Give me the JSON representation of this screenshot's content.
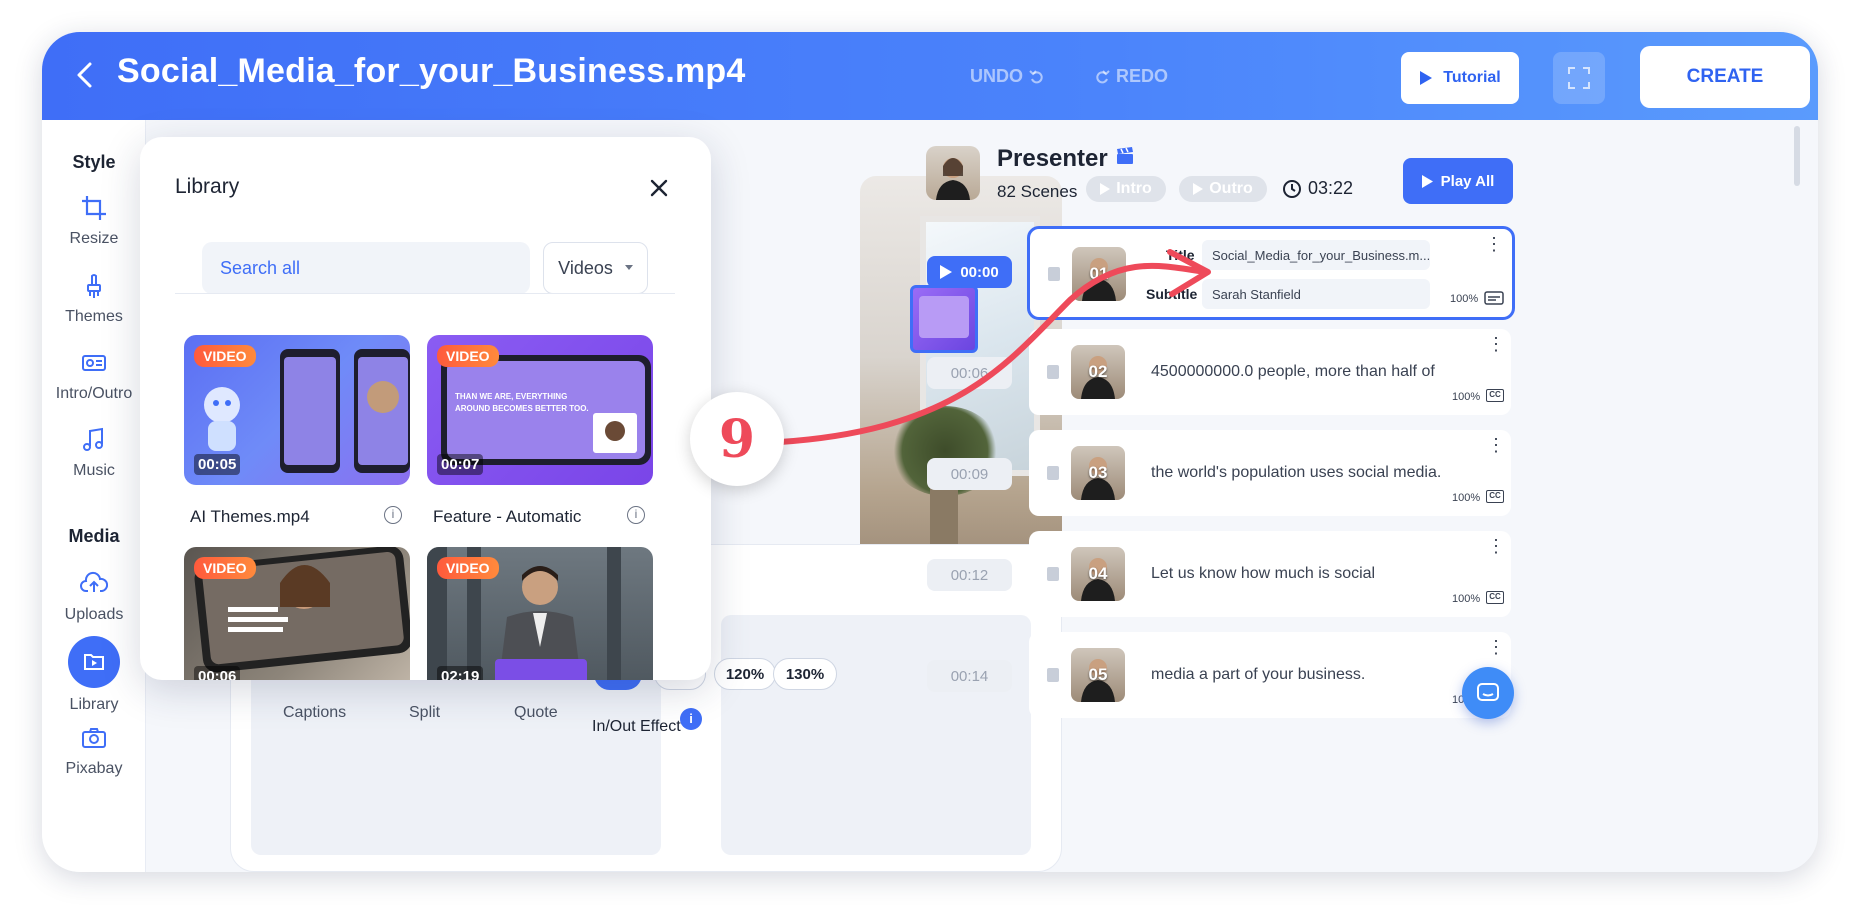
{
  "header": {
    "title": "Social_Media_for_your_Business.mp4",
    "undo_label": "UNDO",
    "redo_label": "REDO",
    "tutorial_label": "Tutorial",
    "create_label": "CREATE"
  },
  "sidebar": {
    "style_heading": "Style",
    "media_heading": "Media",
    "items": [
      {
        "label": "Resize",
        "icon": "crop-icon"
      },
      {
        "label": "Themes",
        "icon": "brush-icon"
      },
      {
        "label": "Intro/Outro",
        "icon": "intro-outro-icon"
      },
      {
        "label": "Music",
        "icon": "music-icon"
      },
      {
        "label": "Uploads",
        "icon": "cloud-upload-icon"
      },
      {
        "label": "Library",
        "icon": "library-icon",
        "active": true
      },
      {
        "label": "Pixabay",
        "icon": "camera-icon"
      }
    ]
  },
  "library": {
    "title": "Library",
    "search_placeholder": "Search all",
    "filter_value": "Videos",
    "items": [
      {
        "badge": "VIDEO",
        "duration": "00:05",
        "name": "AI Themes.mp4"
      },
      {
        "badge": "VIDEO",
        "duration": "00:07",
        "name": "Feature - Automatic"
      },
      {
        "badge": "VIDEO",
        "duration": "00:06",
        "name": ""
      },
      {
        "badge": "VIDEO",
        "duration": "02:19",
        "name": ""
      }
    ],
    "card2_text": "THAN WE ARE, EVERYTHING AROUND BECOMES BETTER TOO."
  },
  "settings": {
    "layouts": [
      "Captions",
      "Split",
      "Quote"
    ],
    "zoom_options": [
      "120%",
      "130%"
    ],
    "effect_label": "In/Out Effect"
  },
  "presenter": {
    "title": "Presenter",
    "scene_count": "82 Scenes",
    "intro_label": "Intro",
    "outro_label": "Outro",
    "total_time": "03:22",
    "play_all_label": "Play All"
  },
  "scenes": [
    {
      "time": "00:00",
      "num": "01",
      "title_label": "Title",
      "title_value": "Social_Media_for_your_Business.m...",
      "subtitle_label": "Subtitle",
      "subtitle_value": "Sarah Stanfield",
      "pct": "100%"
    },
    {
      "time": "00:06",
      "num": "02",
      "text": "4500000000.0 people, more than half of",
      "pct": "100%"
    },
    {
      "time": "00:09",
      "num": "03",
      "text": "the world's population uses social media.",
      "pct": "100%"
    },
    {
      "time": "00:12",
      "num": "04",
      "text": "Let us know how much is social",
      "pct": "100%"
    },
    {
      "time": "00:14",
      "num": "05",
      "text": "media a part of your business.",
      "pct": "100%"
    }
  ],
  "annotation": {
    "step": "9",
    "color": "#ee4a5a"
  },
  "colors": {
    "accent": "#3f6ef7",
    "badge": "#ff5a3c"
  }
}
